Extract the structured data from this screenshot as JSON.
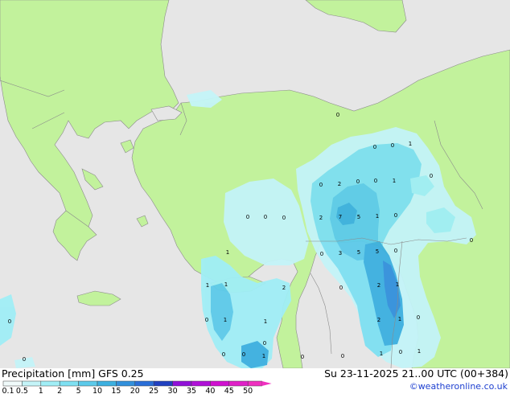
{
  "footer": {
    "title_left": "Precipitation [mm]  GFS 0.25",
    "title_right": "Su 23-11-2025 21..00 UTC (00+384)",
    "credit": "©weatheronline.co.uk"
  },
  "legend": {
    "ticks": [
      "0.1",
      "0.5",
      "1",
      "2",
      "5",
      "10",
      "15",
      "20",
      "25",
      "30",
      "35",
      "40",
      "45",
      "50"
    ],
    "colors": [
      "#f0fafa",
      "#c4f4f8",
      "#a0eef6",
      "#7ee0f2",
      "#5ccaea",
      "#3cb0e0",
      "#3290dc",
      "#2a6ed8",
      "#2040c0",
      "#9010d8",
      "#b010d8",
      "#d010d0",
      "#e020c8",
      "#f030c0"
    ]
  },
  "map_labels": [
    {
      "t": "0"
    },
    {
      "t": "0"
    },
    {
      "t": "1"
    },
    {
      "t": "0"
    },
    {
      "t": "0"
    },
    {
      "t": "2"
    },
    {
      "t": "0"
    },
    {
      "t": "0"
    },
    {
      "t": "1"
    },
    {
      "t": "0"
    },
    {
      "t": "2"
    },
    {
      "t": "7"
    },
    {
      "t": "5"
    },
    {
      "t": "1"
    },
    {
      "t": "0"
    },
    {
      "t": "0"
    },
    {
      "t": "0"
    },
    {
      "t": "0"
    },
    {
      "t": "0"
    },
    {
      "t": "0"
    },
    {
      "t": "3"
    },
    {
      "t": "5"
    },
    {
      "t": "5"
    },
    {
      "t": "0"
    },
    {
      "t": "1"
    },
    {
      "t": "1"
    },
    {
      "t": "2"
    },
    {
      "t": "0"
    },
    {
      "t": "2"
    },
    {
      "t": "1"
    },
    {
      "t": "0"
    },
    {
      "t": "1"
    },
    {
      "t": "1"
    },
    {
      "t": "2"
    },
    {
      "t": "1"
    },
    {
      "t": "0"
    },
    {
      "t": "0"
    },
    {
      "t": "0"
    },
    {
      "t": "1"
    },
    {
      "t": "0"
    },
    {
      "t": "0"
    },
    {
      "t": "1"
    },
    {
      "t": "0"
    },
    {
      "t": "1"
    },
    {
      "t": "0"
    },
    {
      "t": "1"
    },
    {
      "t": "0"
    },
    {
      "t": "0"
    }
  ]
}
